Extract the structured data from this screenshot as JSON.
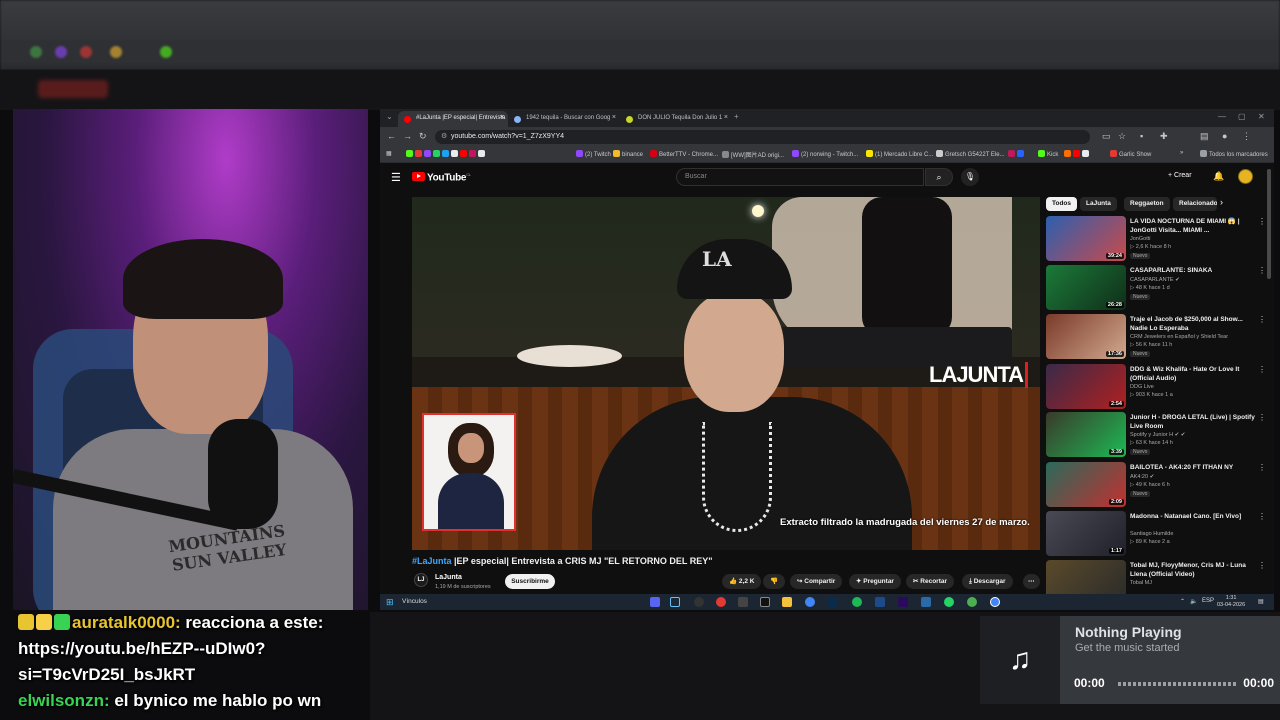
{
  "chat": {
    "msg1_user": "auratalk0000:",
    "msg1_text": " reacciona a este: https://youtu.be/hEZP--uDIw0?si=T9cVrD25I_bsJkRT",
    "msg2_user": "elwilsonzn:",
    "msg2_text": " el bynico me hablo po wn"
  },
  "music": {
    "title": "Nothing Playing",
    "subtitle": "Get the music started",
    "time_current": "00:00",
    "time_total": "00:00",
    "icon": "music-note-icon"
  },
  "webcam": {
    "shirt_text": "MOUNTAINS SUN VALLEY"
  },
  "browser": {
    "tabs": [
      {
        "label": "#LaJunta |EP especial| Entrevista",
        "color": "#ff0000"
      },
      {
        "label": "1942 tequila - Buscar con Goog",
        "color": "#8ab4f8"
      },
      {
        "label": "DON JULIO Tequila Don Julio 1",
        "color": "#c7d629"
      }
    ],
    "url": "youtube.com/watch?v=1_Z7zX9YY4",
    "bookmarks": [
      {
        "label": "(2) Twitch",
        "color": "#9146ff"
      },
      {
        "label": "binance",
        "color": "#f3ba2f"
      },
      {
        "label": "BetterTTV - Chrome...",
        "color": "#d50014"
      },
      {
        "label": "[WW]图片AD origi...",
        "color": "#888888"
      },
      {
        "label": "(2) norwing - Twitch...",
        "color": "#9146ff"
      },
      {
        "label": "(1) Mercado Libre C...",
        "color": "#ffe600"
      },
      {
        "label": "Gretsch G5422T Ele...",
        "color": "#cccccc"
      },
      {
        "label": "Kick",
        "color": "#53fc18"
      },
      {
        "label": "Garlic Show",
        "color": "#e53935"
      },
      {
        "label": "Todos los marcadores",
        "color": "#9aa0a6"
      }
    ]
  },
  "youtube": {
    "logo": "YouTube",
    "logo_country": "CL",
    "search_placeholder": "Buscar",
    "create_label": "+ Crear",
    "video": {
      "title_tag": "#LaJunta",
      "title_rest": " |EP especial| Entrevista a CRIS MJ \"EL RETORNO DEL REY\"",
      "subtitle": "Extracto filtrado la madrugada del viernes 27 de marzo.",
      "brand": "LAJUNTA",
      "cap_text": "LA"
    },
    "channel": {
      "name": "LaJunta",
      "subs": "1,19 M de suscriptores",
      "avatar_text": "LJ"
    },
    "subscribe_label": "Suscribirme",
    "actions": [
      {
        "label": "2,2 K",
        "icon": "thumb-up-icon",
        "glyph": "👍"
      },
      {
        "label": "",
        "icon": "thumb-down-icon",
        "glyph": "👎"
      },
      {
        "label": "Compartir",
        "icon": "share-icon",
        "glyph": "↪"
      },
      {
        "label": "Preguntar",
        "icon": "sparkle-icon",
        "glyph": "✦"
      },
      {
        "label": "Recortar",
        "icon": "scissors-icon",
        "glyph": "✂"
      },
      {
        "label": "Descargar",
        "icon": "download-icon",
        "glyph": "⤓"
      },
      {
        "label": "",
        "icon": "more-icon",
        "glyph": "⋯"
      }
    ],
    "chips": [
      {
        "label": "Todos",
        "active": true
      },
      {
        "label": "LaJunta",
        "active": false
      },
      {
        "label": "Reggaeton",
        "active": false
      },
      {
        "label": "Relacionado",
        "active": false
      }
    ],
    "recommendations": [
      {
        "title": "LA VIDA NOCTURNA DE MIAMI 😱 | JonGotti Visita... MIAMI ...",
        "channel": "JonGotti",
        "meta": "▷ 2,6 K  hace 8 h",
        "badge": "Nuevo",
        "duration": "39:24",
        "color": "#2d5fb0"
      },
      {
        "title": "CASAPARLANTE: SINAKA",
        "channel": "CASAPARLANTE ✔",
        "meta": "▷ 48 K  hace 1 d",
        "badge": "Nuevo",
        "duration": "26:28",
        "color": "#1c7a3a"
      },
      {
        "title": "Traje el Jacob de $250,000 al Show... Nadie Lo Esperaba",
        "channel": "CRM Jewelers en Español y Shield Tear",
        "meta": "▷ 56 K  hace 11 h",
        "badge": "Nuevo",
        "duration": "17:36",
        "color": "#7a3a2a"
      },
      {
        "title": "DDG & Wiz Khalifa - Hate Or Love It (Official Audio)",
        "channel": "DDG Live",
        "meta": "▷ 903 K  hace 1 a",
        "badge": "",
        "duration": "2:54",
        "color": "#3a2a48"
      },
      {
        "title": "Junior H - DROGA LETAL (Live) | Spotify Live Room",
        "channel": "Spotify y Junior H ✔ ✔",
        "meta": "▷ 63 K  hace 14 h",
        "badge": "Nuevo",
        "duration": "3:39",
        "color": "#3a3a2a"
      },
      {
        "title": "BAILOTEA - AK4:20 FT ITHAN NY",
        "channel": "AK4:20 ✔",
        "meta": "▷ 49 K  hace 6 h",
        "badge": "Nuevo",
        "duration": "2:09",
        "color": "#2a6a5a"
      },
      {
        "title": "Madonna - Natanael Cano. [En Vivo]",
        "channel": "Santiago Humilde",
        "meta": "▷ 89 K  hace 2 a",
        "badge": "",
        "duration": "1:17",
        "color": "#4a4a55"
      },
      {
        "title": "Tobal MJ, FloyyMenor, Cris MJ - Luna Llena (Official Video)",
        "channel": "Tobal MJ",
        "meta": "",
        "badge": "",
        "duration": "",
        "color": "#5a4a2a"
      }
    ]
  },
  "taskbar": {
    "label": "Vínculos",
    "lang": "ESP",
    "time": "1:31",
    "date": "03-04-2026"
  }
}
